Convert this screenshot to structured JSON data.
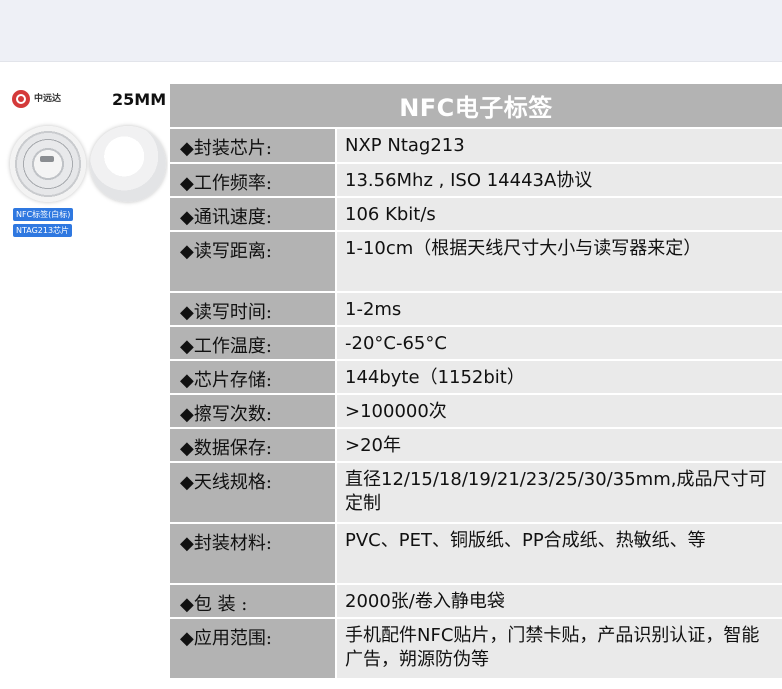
{
  "left_panel": {
    "logo_text": "中远达",
    "size_label": "25MM",
    "badge_1": "NFC标签(白标)",
    "badge_2": "NTAG213芯片"
  },
  "table": {
    "title": "NFC电子标签",
    "rows": [
      {
        "label": "◆封装芯片:",
        "value": "NXP Ntag213"
      },
      {
        "label": "◆工作频率:",
        "value": "13.56Mhz ,  ISO 14443A协议"
      },
      {
        "label": "◆通讯速度:",
        "value": "106 Kbit/s"
      },
      {
        "label": "◆读写距离:",
        "value": "1-10cm（根据天线尺寸大小与读写器来定）"
      },
      {
        "label": "◆读写时间:",
        "value": "1-2ms"
      },
      {
        "label": "◆工作温度:",
        "value": "-20°C-65°C"
      },
      {
        "label": "◆芯片存储:",
        "value": "144byte（1152bit）"
      },
      {
        "label": "◆擦写次数:",
        "value": ">100000次"
      },
      {
        "label": "◆数据保存:",
        "value": ">20年"
      },
      {
        "label": "◆天线规格:",
        "value": "直径12/15/18/19/21/23/25/30/35mm,成品尺寸可定制"
      },
      {
        "label": "◆封装材料:",
        "value": "PVC、PET、铜版纸、PP合成纸、热敏纸、等"
      },
      {
        "label": "◆包    装 :",
        "value": "2000张/卷入静电袋"
      },
      {
        "label": "◆应用范围:",
        "value": "手机配件NFC贴片，门禁卡贴，产品识别认证，智能广告，朔源防伪等"
      }
    ]
  }
}
